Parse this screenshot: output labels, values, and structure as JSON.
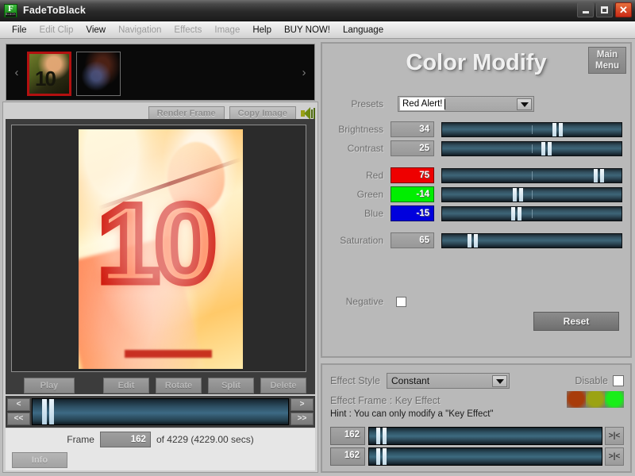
{
  "window": {
    "title": "FadeToBlack",
    "icon_letter": "F",
    "icon_sub": "BLACK",
    "buttons": {
      "minimize": "minimize-button",
      "maximize": "maximize-button",
      "close": "✕"
    }
  },
  "menubar": {
    "items": [
      {
        "label": "File",
        "enabled": true
      },
      {
        "label": "Edit Clip",
        "enabled": false
      },
      {
        "label": "View",
        "enabled": true
      },
      {
        "label": "Navigation",
        "enabled": false
      },
      {
        "label": "Effects",
        "enabled": false
      },
      {
        "label": "Image",
        "enabled": false
      },
      {
        "label": "Help",
        "enabled": true
      },
      {
        "label": "BUY NOW!",
        "enabled": true
      },
      {
        "label": "Language",
        "enabled": true
      }
    ]
  },
  "filmstrip": {
    "prev_arrow": "‹",
    "next_arrow": "›",
    "thumbnails": [
      {
        "selected": true
      },
      {
        "selected": false
      }
    ]
  },
  "preview_toolbar": {
    "render_frame_label": "Render Frame",
    "copy_image_label": "Copy Image",
    "sound_icon": "speaker-icon"
  },
  "playback_buttons": [
    {
      "label": "Play"
    },
    {
      "label": "Edit"
    },
    {
      "label": "Rotate"
    },
    {
      "label": "Split"
    },
    {
      "label": "Delete"
    }
  ],
  "timeline": {
    "nav_prev": "<",
    "nav_prev_fast": "<<",
    "nav_next": ">",
    "nav_next_fast": ">>",
    "position_pct": 6
  },
  "frame_info": {
    "label": "Frame",
    "value": "162",
    "of_text": "of 4229 (4229.00 secs)",
    "info_label": "Info"
  },
  "color_modify": {
    "title": "Color Modify",
    "main_menu_label": "Main\nMenu",
    "main_menu_line1": "Main",
    "main_menu_line2": "Menu",
    "presets": {
      "label": "Presets",
      "value": "Red Alert!"
    },
    "sliders": [
      {
        "label": "Brightness",
        "value": "34",
        "pct": 64,
        "style": "plain"
      },
      {
        "label": "Contrast",
        "value": "25",
        "pct": 58,
        "style": "plain"
      },
      {
        "label": "Red",
        "value": "75",
        "pct": 87,
        "style": "red"
      },
      {
        "label": "Green",
        "value": "-14",
        "pct": 42,
        "style": "green"
      },
      {
        "label": "Blue",
        "value": "-15",
        "pct": 41,
        "style": "blue"
      },
      {
        "label": "Saturation",
        "value": "65",
        "pct": 17,
        "style": "plain"
      }
    ],
    "negative": {
      "label": "Negative",
      "checked": false
    },
    "reset_label": "Reset"
  },
  "effect_panel": {
    "style_label": "Effect Style",
    "style_value": "Constant",
    "disable_label": "Disable",
    "disable_checked": false,
    "frame_text": "Effect Frame : Key Effect",
    "hint_text": "Hint : You can only modify a \"Key Effect\"",
    "lights": [
      "#a83c0a",
      "#9ba312",
      "#19ee19"
    ],
    "keyframes": [
      {
        "value": "162",
        "pct": 5,
        "button_label": ">|<"
      },
      {
        "value": "162",
        "pct": 5,
        "button_label": ">|<"
      }
    ]
  },
  "colors": {
    "accent_red": "#ee0000",
    "accent_green": "#00ee00",
    "accent_blue": "#0000dd",
    "panel_bg": "#b9b9b9",
    "slider_track": "#3d6a84"
  }
}
